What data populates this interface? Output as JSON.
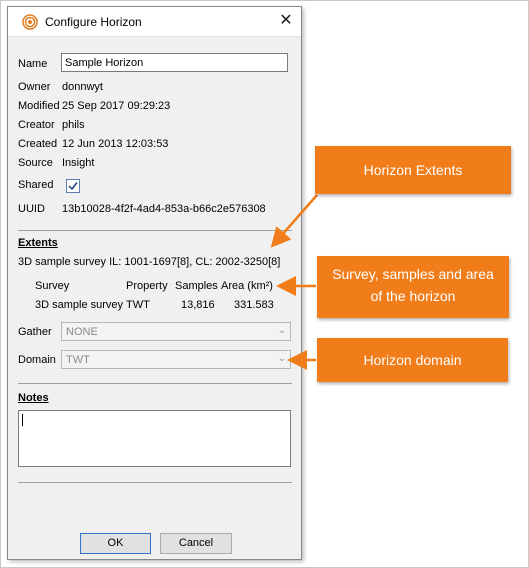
{
  "window": {
    "title": "Configure Horizon",
    "close_glyph": "✕"
  },
  "fields": {
    "name_label": "Name",
    "name_value": "Sample Horizon",
    "owner_label": "Owner",
    "owner_value": "donnwyt",
    "modified_label": "Modified",
    "modified_value": "25 Sep 2017 09:29:23",
    "creator_label": "Creator",
    "creator_value": "phils",
    "created_label": "Created",
    "created_value": "12 Jun 2013 12:03:53",
    "source_label": "Source",
    "source_value": "Insight",
    "shared_label": "Shared",
    "shared_checked": true,
    "uuid_label": "UUID",
    "uuid_value": "13b10028-4f2f-4ad4-853a-b66c2e576308"
  },
  "extents": {
    "title": "Extents",
    "summary": "3D sample survey IL: 1001-1697[8], CL: 2002-3250[8]",
    "table": {
      "headers": [
        "Survey",
        "Property",
        "Samples",
        "Area (km²)"
      ],
      "rows": [
        [
          "3D sample survey",
          "TWT",
          "13,816",
          "331.583"
        ]
      ]
    }
  },
  "gather": {
    "label": "Gather",
    "value": "NONE",
    "arrow": "⌄"
  },
  "domain": {
    "label": "Domain",
    "value": "TWT",
    "arrow": "⌄"
  },
  "notes": {
    "title": "Notes",
    "value": ""
  },
  "buttons": {
    "ok": "OK",
    "cancel": "Cancel"
  },
  "callouts": {
    "extents": "Horizon Extents",
    "survey_line1": "Survey, samples and area",
    "survey_line2": "of the  horizon",
    "domain": "Horizon domain"
  },
  "colors": {
    "accent": "#f07d19",
    "dialog_bg": "#f0f0f0"
  },
  "icons": {
    "title_icon": "horizon-app-icon",
    "check": "check-icon",
    "close": "close-icon"
  }
}
